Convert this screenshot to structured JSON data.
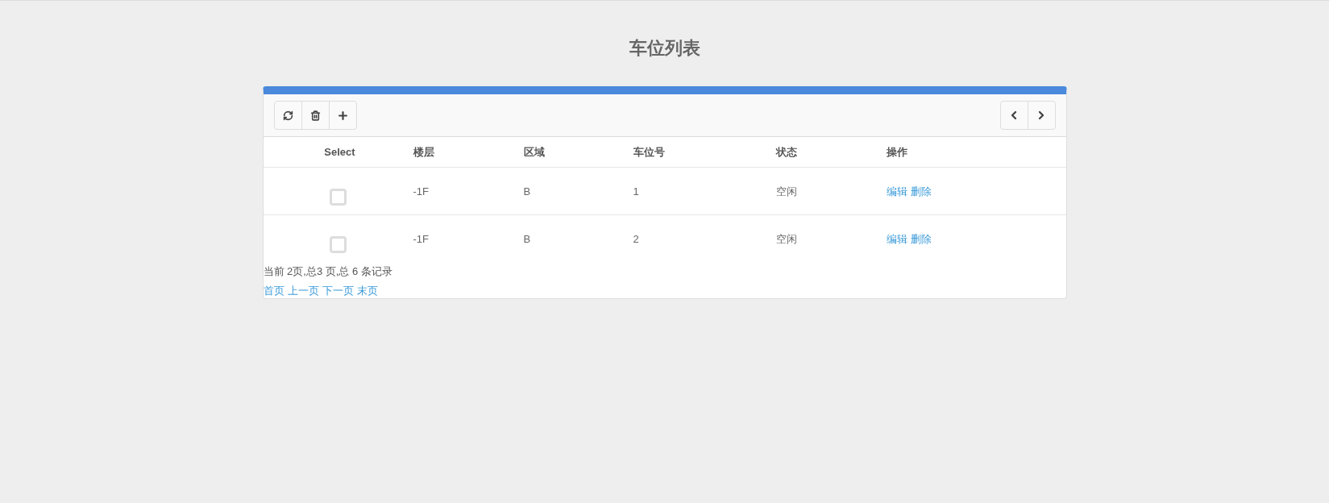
{
  "page": {
    "title": "车位列表"
  },
  "table": {
    "columns": [
      "Select",
      "楼层",
      "区域",
      "车位号",
      "状态",
      "操作"
    ],
    "rows": [
      {
        "checked": false,
        "floor": "-1F",
        "area": "B",
        "number": "1",
        "status": "空闲",
        "actions": [
          "编辑",
          "删除"
        ]
      },
      {
        "checked": false,
        "floor": "-1F",
        "area": "B",
        "number": "2",
        "status": "空闲",
        "actions": [
          "编辑",
          "删除"
        ]
      }
    ]
  },
  "pagination": {
    "summary": "当前 2页,总3 页,总 6 条记录",
    "links": [
      "首页",
      "上一页",
      "下一页",
      "末页"
    ]
  }
}
